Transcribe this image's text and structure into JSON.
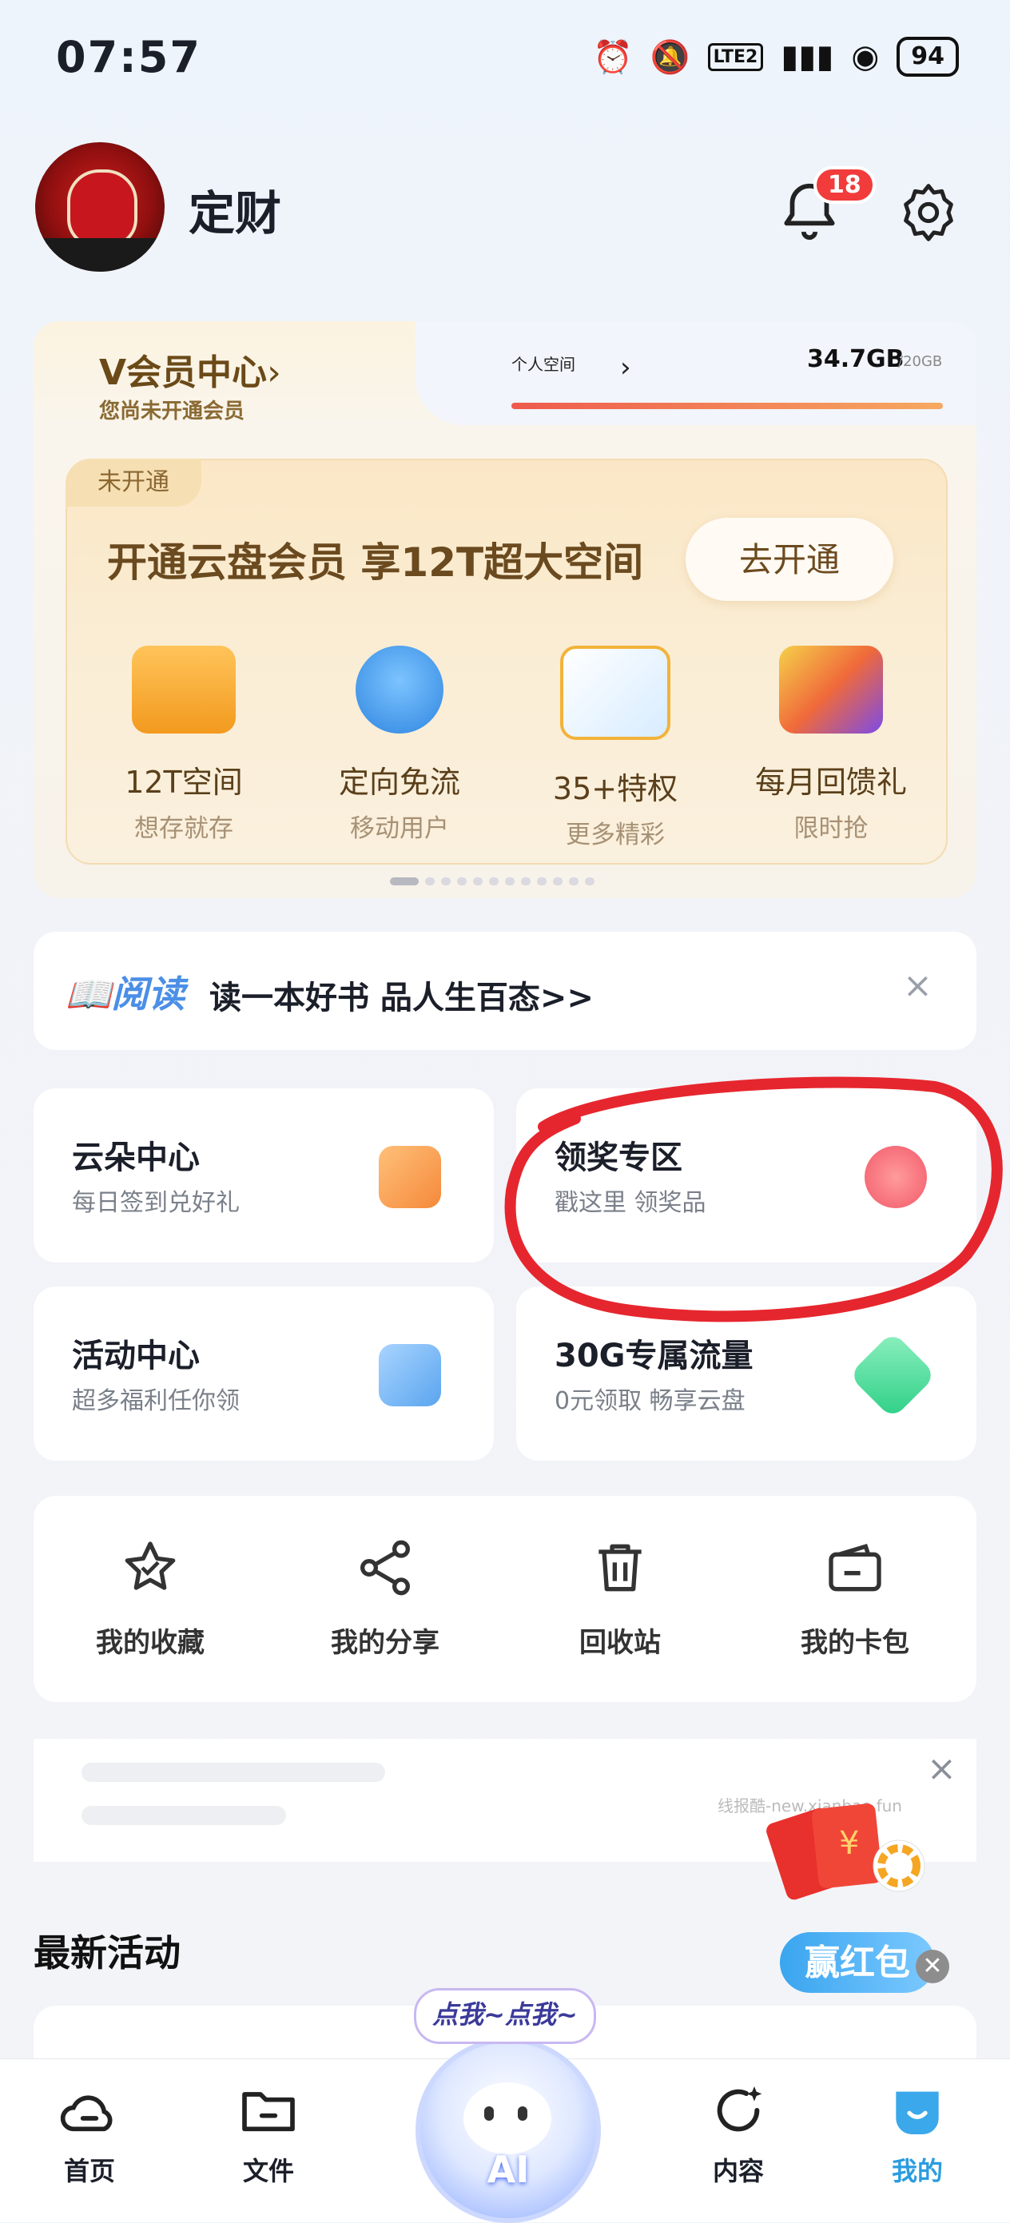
{
  "status": {
    "time": "07:57",
    "battery": "94",
    "net": "LTE2"
  },
  "header": {
    "username": "定财",
    "notification_count": "18"
  },
  "vip": {
    "title": "V会员中心",
    "chevron": "›",
    "subtitle": "您尚未开通会员",
    "space_label": "个人空间",
    "space_used": "34.7GB",
    "space_total": "/20GB"
  },
  "promo": {
    "tag": "未开通",
    "title": "开通云盘会员  享12T超大空间",
    "button": "去开通",
    "features": [
      {
        "label": "12T空间",
        "sub": "想存就存",
        "icon": "folder-icon",
        "color": "#f5a623"
      },
      {
        "label": "定向免流",
        "sub": "移动用户",
        "icon": "wifi-icon",
        "color": "#3a8ee6"
      },
      {
        "label": "35+特权",
        "sub": "更多精彩",
        "icon": "cloud-icon",
        "color": "#3ba6f0"
      },
      {
        "label": "每月回馈礼",
        "sub": "限时抢",
        "icon": "gift-apps-icon",
        "color": "#f0513a"
      }
    ]
  },
  "reading": {
    "logo": "阅读",
    "text": "读一本好书 品人生百态>>",
    "close": "×"
  },
  "cards": [
    {
      "title": "云朵中心",
      "sub": "每日签到兑好礼",
      "icon": "calendar-check-icon",
      "color": "#f6a35c"
    },
    {
      "title": "领奖专区",
      "sub": "戳这里 领奖品",
      "icon": "gift-icon",
      "color": "#f47a7a"
    },
    {
      "title": "活动中心",
      "sub": "超多福利任你领",
      "icon": "clock-folder-icon",
      "color": "#79b6f5"
    },
    {
      "title": "30G专属流量",
      "sub": "0元领取 畅享云盘",
      "icon": "data-diamond-icon",
      "color": "#4ed59a"
    }
  ],
  "quick_actions": [
    {
      "label": "我的收藏",
      "icon": "star-icon"
    },
    {
      "label": "我的分享",
      "icon": "share-icon"
    },
    {
      "label": "回收站",
      "icon": "trash-icon"
    },
    {
      "label": "我的卡包",
      "icon": "wallet-icon"
    }
  ],
  "ad": {
    "close": "×",
    "text": "线报酷-new.xianbao.fun"
  },
  "redpack": {
    "button": "赢红包",
    "close": "✕"
  },
  "section": {
    "latest": "最新活动"
  },
  "nav": {
    "items": [
      {
        "label": "首页",
        "icon": "cloud-home-icon"
      },
      {
        "label": "文件",
        "icon": "folder-icon"
      },
      {
        "label": "内容",
        "icon": "refresh-star-icon"
      },
      {
        "label": "我的",
        "icon": "profile-face-icon"
      }
    ],
    "ai_bubble": "点我~点我~",
    "ai_label": "AI"
  },
  "colors": {
    "accent_blue": "#2a9ce0",
    "badge_red": "#f23b3b",
    "vip_gold": "#6b4a18"
  }
}
